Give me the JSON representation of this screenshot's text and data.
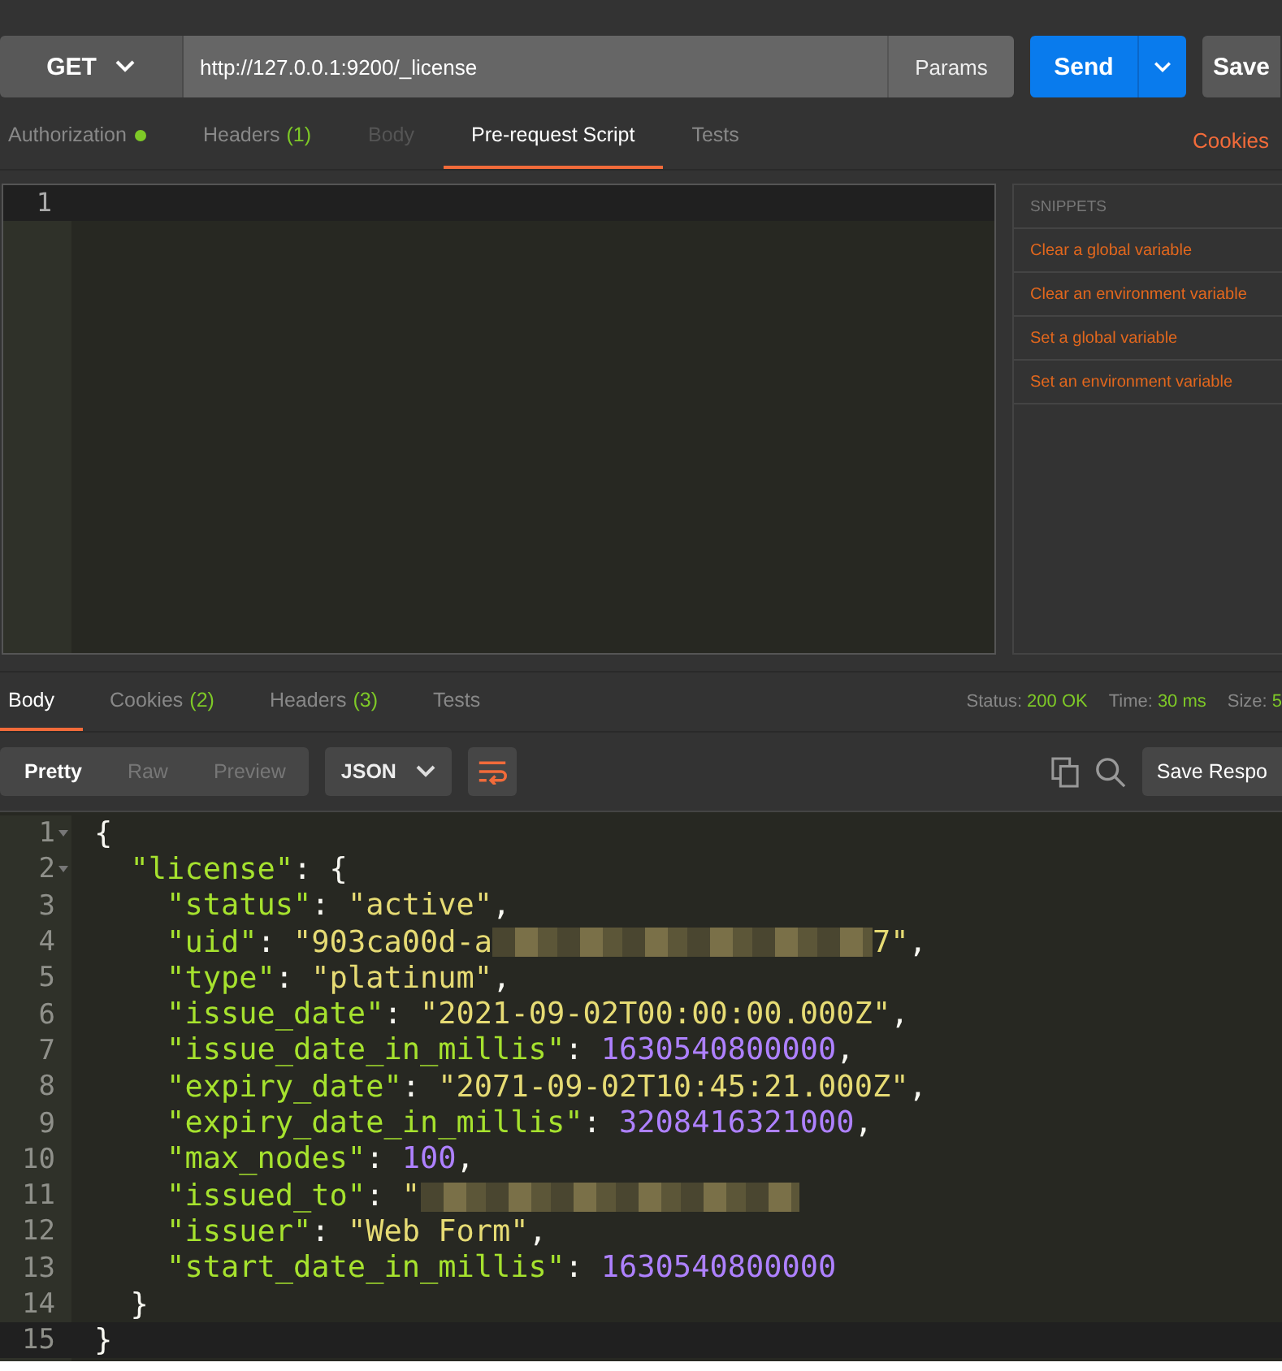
{
  "request": {
    "method": "GET",
    "url": "http://127.0.0.1:9200/_license",
    "params_label": "Params",
    "send_label": "Send",
    "save_label": "Save"
  },
  "request_tabs": [
    {
      "label": "Authorization",
      "dot": true,
      "disabled": false,
      "selected": false
    },
    {
      "label": "Headers",
      "count": "(1)",
      "dot": false,
      "disabled": false,
      "selected": false
    },
    {
      "label": "Body",
      "dot": false,
      "disabled": true,
      "selected": false
    },
    {
      "label": "Pre-request Script",
      "dot": false,
      "disabled": false,
      "selected": true
    },
    {
      "label": "Tests",
      "dot": false,
      "disabled": false,
      "selected": false
    }
  ],
  "cookies_link": "Cookies",
  "script_editor": {
    "line_numbers": [
      "1"
    ]
  },
  "snippets": {
    "title": "SNIPPETS",
    "items": [
      "Clear a global variable",
      "Clear an environment variable",
      "Set a global variable",
      "Set an environment variable"
    ]
  },
  "response_tabs": [
    {
      "label": "Body",
      "selected": true
    },
    {
      "label": "Cookies",
      "count": "(2)",
      "selected": false
    },
    {
      "label": "Headers",
      "count": "(3)",
      "selected": false
    },
    {
      "label": "Tests",
      "selected": false
    }
  ],
  "response_meta": [
    {
      "label": "Status:",
      "value": "200 OK"
    },
    {
      "label": "Time:",
      "value": "30 ms"
    },
    {
      "label": "Size:",
      "value": "5"
    }
  ],
  "view_modes": [
    {
      "label": "Pretty",
      "selected": true
    },
    {
      "label": "Raw",
      "selected": false
    },
    {
      "label": "Preview",
      "selected": false
    }
  ],
  "format": "JSON",
  "save_response_label": "Save Respo",
  "response_body": [
    {
      "number": "1",
      "foldable": true,
      "current": false,
      "tokens": [
        {
          "kind": "punct",
          "text": "{"
        }
      ]
    },
    {
      "number": "2",
      "foldable": true,
      "current": false,
      "tokens": [
        {
          "kind": "key",
          "text": "  \"license\""
        },
        {
          "kind": "punct",
          "text": ": {"
        }
      ]
    },
    {
      "number": "3",
      "foldable": false,
      "current": false,
      "tokens": [
        {
          "kind": "key",
          "text": "    \"status\""
        },
        {
          "kind": "punct",
          "text": ": "
        },
        {
          "kind": "string",
          "text": "\"active\""
        },
        {
          "kind": "punct",
          "text": ","
        }
      ]
    },
    {
      "number": "4",
      "foldable": false,
      "current": false,
      "tokens": [
        {
          "kind": "key",
          "text": "    \"uid\""
        },
        {
          "kind": "punct",
          "text": ": "
        },
        {
          "kind": "string",
          "text": "\"903ca00d-a"
        },
        {
          "kind": "redacted"
        },
        {
          "kind": "string",
          "text": "7\""
        },
        {
          "kind": "punct",
          "text": ","
        }
      ]
    },
    {
      "number": "5",
      "foldable": false,
      "current": false,
      "tokens": [
        {
          "kind": "key",
          "text": "    \"type\""
        },
        {
          "kind": "punct",
          "text": ": "
        },
        {
          "kind": "string",
          "text": "\"platinum\""
        },
        {
          "kind": "punct",
          "text": ","
        }
      ]
    },
    {
      "number": "6",
      "foldable": false,
      "current": false,
      "tokens": [
        {
          "kind": "key",
          "text": "    \"issue_date\""
        },
        {
          "kind": "punct",
          "text": ": "
        },
        {
          "kind": "string",
          "text": "\"2021-09-02T00:00:00.000Z\""
        },
        {
          "kind": "punct",
          "text": ","
        }
      ]
    },
    {
      "number": "7",
      "foldable": false,
      "current": false,
      "tokens": [
        {
          "kind": "key",
          "text": "    \"issue_date_in_millis\""
        },
        {
          "kind": "punct",
          "text": ": "
        },
        {
          "kind": "number",
          "text": "1630540800000"
        },
        {
          "kind": "punct",
          "text": ","
        }
      ]
    },
    {
      "number": "8",
      "foldable": false,
      "current": false,
      "tokens": [
        {
          "kind": "key",
          "text": "    \"expiry_date\""
        },
        {
          "kind": "punct",
          "text": ": "
        },
        {
          "kind": "string",
          "text": "\"2071-09-02T10:45:21.000Z\""
        },
        {
          "kind": "punct",
          "text": ","
        }
      ]
    },
    {
      "number": "9",
      "foldable": false,
      "current": false,
      "tokens": [
        {
          "kind": "key",
          "text": "    \"expiry_date_in_millis\""
        },
        {
          "kind": "punct",
          "text": ": "
        },
        {
          "kind": "number",
          "text": "3208416321000"
        },
        {
          "kind": "punct",
          "text": ","
        }
      ]
    },
    {
      "number": "10",
      "foldable": false,
      "current": false,
      "tokens": [
        {
          "kind": "key",
          "text": "    \"max_nodes\""
        },
        {
          "kind": "punct",
          "text": ": "
        },
        {
          "kind": "number",
          "text": "100"
        },
        {
          "kind": "punct",
          "text": ","
        }
      ]
    },
    {
      "number": "11",
      "foldable": false,
      "current": false,
      "tokens": [
        {
          "kind": "key",
          "text": "    \"issued_to\""
        },
        {
          "kind": "punct",
          "text": ": "
        },
        {
          "kind": "string",
          "text": "\""
        },
        {
          "kind": "redacted"
        }
      ]
    },
    {
      "number": "12",
      "foldable": false,
      "current": false,
      "tokens": [
        {
          "kind": "key",
          "text": "    \"issuer\""
        },
        {
          "kind": "punct",
          "text": ": "
        },
        {
          "kind": "string",
          "text": "\"Web Form\""
        },
        {
          "kind": "punct",
          "text": ","
        }
      ]
    },
    {
      "number": "13",
      "foldable": false,
      "current": false,
      "tokens": [
        {
          "kind": "key",
          "text": "    \"start_date_in_millis\""
        },
        {
          "kind": "punct",
          "text": ": "
        },
        {
          "kind": "number",
          "text": "1630540800000"
        }
      ]
    },
    {
      "number": "14",
      "foldable": false,
      "current": false,
      "tokens": [
        {
          "kind": "punct",
          "text": "  }"
        }
      ]
    },
    {
      "number": "15",
      "foldable": false,
      "current": true,
      "tokens": [
        {
          "kind": "punct",
          "text": "}"
        }
      ]
    }
  ]
}
